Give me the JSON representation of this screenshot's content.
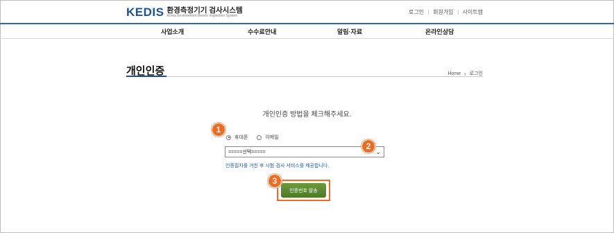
{
  "header": {
    "logo_mark": "KEDIS",
    "logo_title": "환경측정기기 검사시스템",
    "logo_subtitle": "Korea Environment Device Inspection System",
    "util_links": [
      "로그인",
      "회원가입",
      "사이트맵"
    ]
  },
  "nav": {
    "items": [
      "사업소개",
      "수수료안내",
      "알림·자료",
      "온라인상담"
    ]
  },
  "page": {
    "title": "개인인증",
    "breadcrumb": [
      "Home",
      "로그인"
    ]
  },
  "form": {
    "instruction": "개인인증 방법을 체크해주세요.",
    "radio_options": [
      {
        "label": "휴대폰",
        "selected": true
      },
      {
        "label": "이메일",
        "selected": false
      }
    ],
    "select_value": "=====선택=====",
    "notice": "인증절차를 거친 후 시험·검사 서비스를 제공합니다.",
    "send_label": "인증번호 발송"
  },
  "markers": [
    "1",
    "2",
    "3"
  ],
  "colors": {
    "brand_blue": "#1a4f9c",
    "nav_border": "#2b6ab3",
    "button_green": "#5b8a2e",
    "marker_orange": "#ef6b22",
    "notice_blue": "#1a5aa8"
  }
}
